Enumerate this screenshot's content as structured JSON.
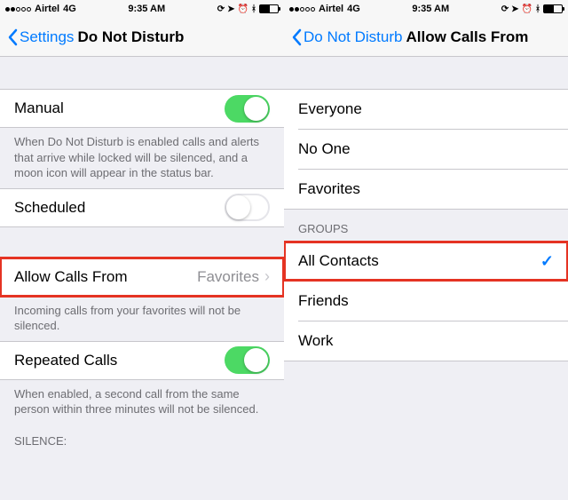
{
  "status": {
    "carrier": "Airtel",
    "network": "4G",
    "time": "9:35 AM"
  },
  "left": {
    "back": "Settings",
    "title": "Do Not Disturb",
    "manual": {
      "label": "Manual",
      "on": true
    },
    "manual_footer": "When Do Not Disturb is enabled calls and alerts that arrive while locked will be silenced, and a moon icon will appear in the status bar.",
    "scheduled": {
      "label": "Scheduled",
      "on": false
    },
    "allow": {
      "label": "Allow Calls From",
      "value": "Favorites"
    },
    "allow_footer": "Incoming calls from your favorites will not be silenced.",
    "repeated": {
      "label": "Repeated Calls",
      "on": true
    },
    "repeated_footer": "When enabled, a second call from the same person within three minutes will not be silenced.",
    "silence_header": "SILENCE:"
  },
  "right": {
    "back": "Do Not Disturb",
    "title": "Allow Calls From",
    "options": {
      "everyone": "Everyone",
      "noone": "No One",
      "favorites": "Favorites"
    },
    "groups_header": "GROUPS",
    "groups": {
      "all": "All Contacts",
      "friends": "Friends",
      "work": "Work"
    },
    "selected": "all"
  }
}
